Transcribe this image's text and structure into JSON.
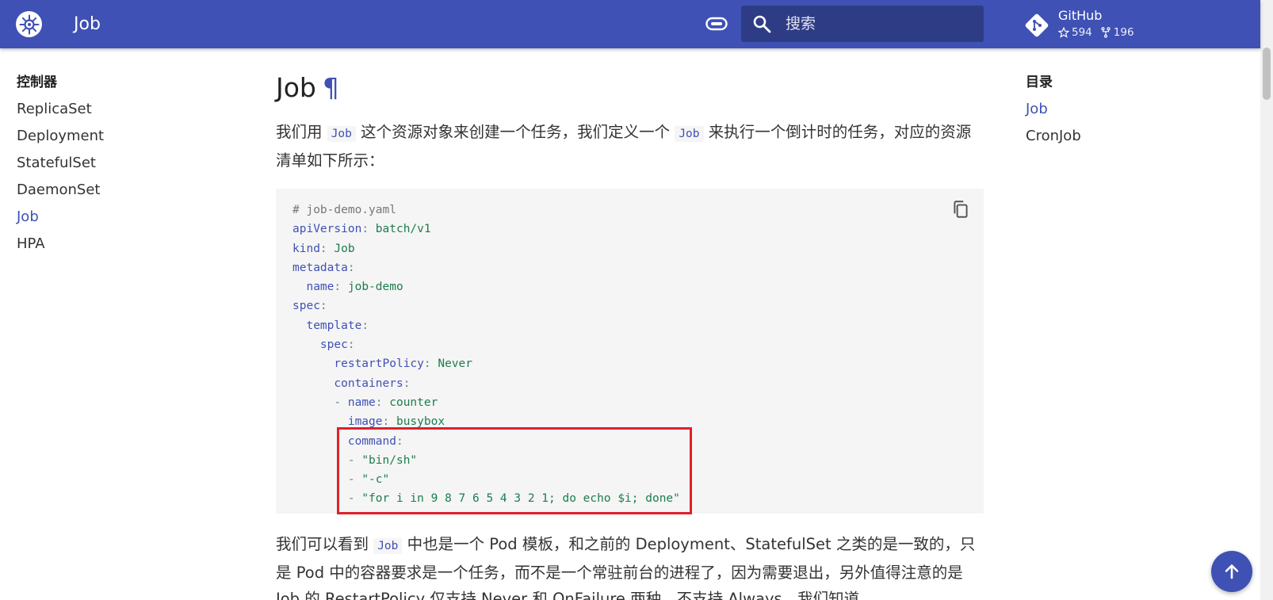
{
  "header": {
    "site_title": "Job",
    "search_placeholder": "搜索",
    "repo": {
      "name": "GitHub",
      "stars": "594",
      "forks": "196"
    }
  },
  "sidebar": {
    "title": "控制器",
    "items": [
      {
        "label": "ReplicaSet",
        "active": false
      },
      {
        "label": "Deployment",
        "active": false
      },
      {
        "label": "StatefulSet",
        "active": false
      },
      {
        "label": "DaemonSet",
        "active": false
      },
      {
        "label": "Job",
        "active": true
      },
      {
        "label": "HPA",
        "active": false
      }
    ]
  },
  "toc": {
    "title": "目录",
    "items": [
      {
        "label": "Job",
        "active": true
      },
      {
        "label": "CronJob",
        "active": false
      }
    ]
  },
  "article": {
    "title": "Job",
    "permalink": "¶",
    "intro": {
      "t1": "我们用 ",
      "code1": "Job",
      "t2": " 这个资源对象来创建一个任务，我们定义一个 ",
      "code2": "Job",
      "t3": " 来执行一个倒计时的任务，对应的资源清单如下所示："
    },
    "code_lines": [
      {
        "indent": "",
        "comment": "# job-demo.yaml"
      },
      {
        "indent": "",
        "key": "apiVersion",
        "value": "batch/v1"
      },
      {
        "indent": "",
        "key": "kind",
        "value": "Job"
      },
      {
        "indent": "",
        "key": "metadata",
        "value": ""
      },
      {
        "indent": "  ",
        "key": "name",
        "value": "job-demo"
      },
      {
        "indent": "",
        "key": "spec",
        "value": ""
      },
      {
        "indent": "  ",
        "key": "template",
        "value": ""
      },
      {
        "indent": "    ",
        "key": "spec",
        "value": ""
      },
      {
        "indent": "      ",
        "key": "restartPolicy",
        "value": "Never"
      },
      {
        "indent": "      ",
        "key": "containers",
        "value": ""
      },
      {
        "indent": "      ",
        "dash": "- ",
        "key": "name",
        "value": "counter"
      },
      {
        "indent": "        ",
        "key": "image",
        "value": "busybox"
      },
      {
        "indent": "        ",
        "key": "command",
        "value": ""
      },
      {
        "indent": "        ",
        "dash": "- ",
        "str": "\"bin/sh\""
      },
      {
        "indent": "        ",
        "dash": "- ",
        "str": "\"-c\""
      },
      {
        "indent": "        ",
        "dash": "- ",
        "str": "\"for i in 9 8 7 6 5 4 3 2 1; do echo $i; done\""
      }
    ],
    "after": {
      "t1": "我们可以看到 ",
      "code1": "Job",
      "t2": " 中也是一个 Pod 模板，和之前的 Deployment、StatefulSet 之类的是一致的，只是 Pod 中的容器要求是一个任务，而不是一个常驻前台的进程了，因为需要退出，另外值得注意的是 Job 的 RestartPolicy 仅支持 Never 和 OnFailure 两种，不支持 Always，我们知道"
    }
  },
  "colors": {
    "primary": "#3f51b5",
    "highlight_border": "#e0202a"
  }
}
